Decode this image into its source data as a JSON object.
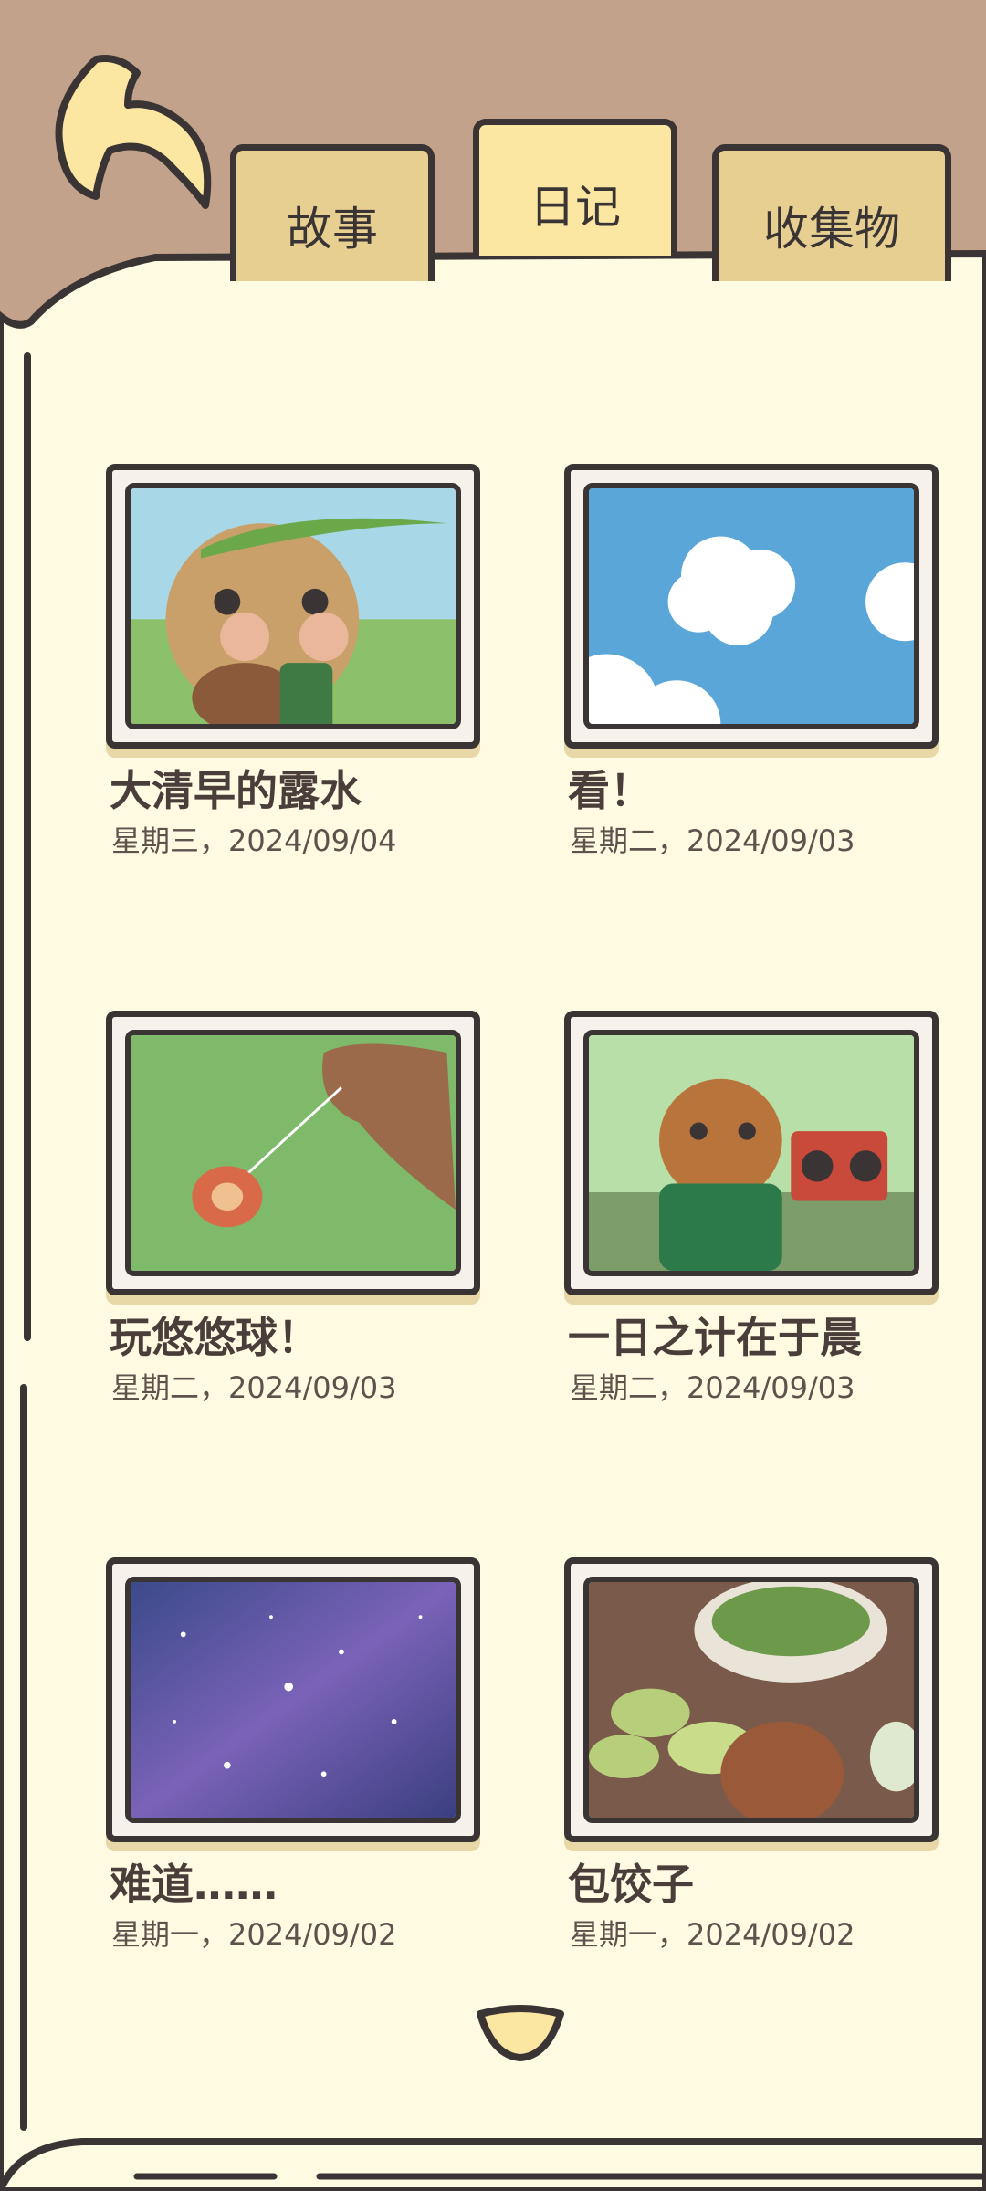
{
  "tabs": [
    {
      "label": "故事",
      "active": false
    },
    {
      "label": "日记",
      "active": true
    },
    {
      "label": "收集物",
      "active": false
    }
  ],
  "diary": [
    {
      "title": "大清早的露水",
      "date": "星期三，2024/09/04",
      "image": "squirrel-dew-drop"
    },
    {
      "title": "看！",
      "date": "星期二，2024/09/03",
      "image": "cloud-in-sky"
    },
    {
      "title": "玩悠悠球！",
      "date": "星期二，2024/09/03",
      "image": "yoyo-on-grass"
    },
    {
      "title": "一日之计在于晨",
      "date": "星期二，2024/09/03",
      "image": "squirrel-with-radio"
    },
    {
      "title": "难道……",
      "date": "星期一，2024/09/02",
      "image": "starry-night-sky"
    },
    {
      "title": "包饺子",
      "date": "星期一，2024/09/02",
      "image": "making-dumplings"
    }
  ],
  "colors": {
    "header": "#c2a28a",
    "paper": "#fffbe3",
    "outline": "#3b3434",
    "tab": "#e6cf91",
    "tab_active": "#fbe6a2"
  },
  "icons": {
    "back": "curved-back-arrow-icon",
    "next_page": "chevron-down-icon"
  }
}
